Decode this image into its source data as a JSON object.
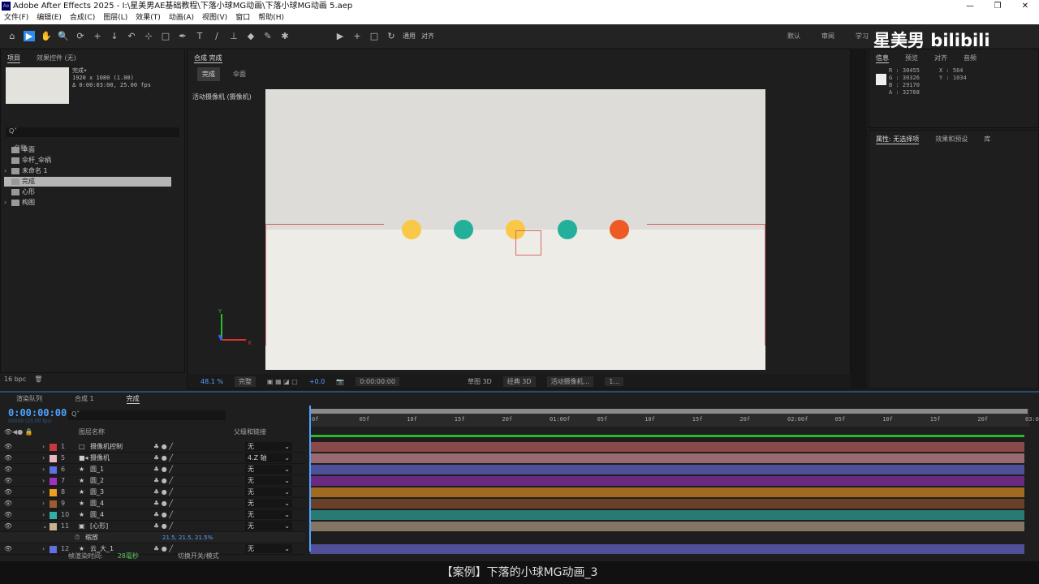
{
  "window": {
    "title": "Adobe After Effects 2025 - I:\\星美男AE基础教程\\下落小球MG动画\\下落小球MG动画 5.aep",
    "app_icon": "Ae",
    "controls": [
      "—",
      "❐",
      "✕"
    ]
  },
  "menu": [
    "文件(F)",
    "编辑(E)",
    "合成(C)",
    "图层(L)",
    "效果(T)",
    "动画(A)",
    "视图(V)",
    "窗口",
    "帮助(H)"
  ],
  "toolbar": {
    "tools": [
      "home-icon",
      "selection-icon",
      "hand-icon",
      "zoom-icon",
      "orbit-icon",
      "pan-icon",
      "dolly-icon",
      "rotate-icon",
      "anchor-icon",
      "rectangle-icon",
      "pen-icon",
      "text-icon",
      "brush-icon",
      "stamp-icon",
      "eraser-icon",
      "roto-icon",
      "puppet-icon"
    ],
    "general_label": "通用",
    "align_label": "对齐"
  },
  "workspaces": [
    "默认",
    "审阅",
    "学习"
  ],
  "watermark": "星美男  bilibili",
  "project": {
    "tabs": [
      "项目",
      "效果控件 (无)"
    ],
    "comp_name": "完成▾",
    "comp_size": "1920 x 1080 (1.00)",
    "comp_duration": "Δ 0:00:03:00, 25.00 fps",
    "search_placeholder": "Q˅",
    "column_name": "名称",
    "items": [
      {
        "name": "伞面",
        "type": "comp"
      },
      {
        "name": "伞杆_伞柄",
        "type": "comp"
      },
      {
        "name": "未命名 1",
        "type": "folder"
      },
      {
        "name": "完成",
        "type": "comp",
        "selected": true
      },
      {
        "name": "心形",
        "type": "comp"
      },
      {
        "name": "构图",
        "type": "folder"
      }
    ],
    "bpc": "16 bpc"
  },
  "viewer": {
    "tab": "合成 完成",
    "breadcrumbs": [
      "完成",
      "伞面"
    ],
    "camera_label": "活动摄像机 (摄像机)",
    "zoom": "48.1 %",
    "resolution": "完整",
    "exposure": "+0.0",
    "timecode": "0:00:00:00",
    "draft3d": "草图 3D",
    "renderer": "经典 3D",
    "view": "活动摄像机...",
    "views": "1...",
    "scene": {
      "bg_top": "#dedcd8",
      "bg_bottom": "#eeece6",
      "balls": [
        "#f9c846",
        "#23b09a",
        "#f9c846",
        "#23b09a",
        "#ee5a24"
      ]
    }
  },
  "info": {
    "tabs": [
      "信息",
      "预览",
      "对齐",
      "音频"
    ],
    "R": "R : 30455",
    "G": "G : 30326",
    "B": "B : 29170",
    "A": "A : 32768",
    "X": "X : 564",
    "Y": "Y : 1034"
  },
  "properties": {
    "tabs": [
      "属性: 无选择项",
      "效果和预设",
      "库"
    ]
  },
  "timeline": {
    "tabs": [
      "渲染队列",
      "合成 1",
      "完成"
    ],
    "timecode": "0:00:00:00",
    "fps": "00000 (25.00 fps)",
    "search_placeholder": "Q˅",
    "col_name": "图层名称",
    "col_parent": "父级和链接",
    "ticks": [
      "0f",
      "05f",
      "10f",
      "15f",
      "20f",
      "01:00f",
      "05f",
      "10f",
      "15f",
      "20f",
      "02:00f",
      "05f",
      "10f",
      "15f",
      "20f",
      "03:0"
    ],
    "layers": [
      {
        "num": "1",
        "name": "摄像机控制",
        "icon": "□",
        "label": "#c8383f",
        "bar": "#8a4a4a",
        "parent": "无"
      },
      {
        "num": "5",
        "name": "摄像机",
        "icon": "■◂",
        "label": "#e8b8c0",
        "bar": "#9a6a72",
        "parent": "4.Z 轴"
      },
      {
        "num": "6",
        "name": "圆_1",
        "icon": "★",
        "label": "#6070e0",
        "bar": "#50509a",
        "parent": "无"
      },
      {
        "num": "7",
        "name": "圆_2",
        "icon": "★",
        "label": "#a030c0",
        "bar": "#6a2a80",
        "parent": "无"
      },
      {
        "num": "8",
        "name": "圆_3",
        "icon": "★",
        "label": "#f0a020",
        "bar": "#a06a20",
        "parent": "无"
      },
      {
        "num": "9",
        "name": "圆_4",
        "icon": "★",
        "label": "#a05a30",
        "bar": "#6a4028",
        "parent": "无"
      },
      {
        "num": "10",
        "name": "圆_4",
        "icon": "★",
        "label": "#30b0a8",
        "bar": "#2a7a74",
        "parent": "无"
      },
      {
        "num": "11",
        "name": "[心形]",
        "icon": "▣",
        "label": "#c8b090",
        "bar": "#857565",
        "parent": "无",
        "expanded": true
      },
      {
        "num": "12",
        "name": "云_大_1",
        "icon": "★",
        "label": "#6070e0",
        "bar": "#50509a",
        "parent": "无"
      }
    ],
    "property": {
      "name": "缩放",
      "value": "21.5, 21.5, 21.5%"
    },
    "footer": {
      "render_label": "帧渲染时间:",
      "render_time": "28毫秒",
      "toggle": "切换开关/模式"
    }
  },
  "caption": "【案例】下落的小球MG动画_3"
}
